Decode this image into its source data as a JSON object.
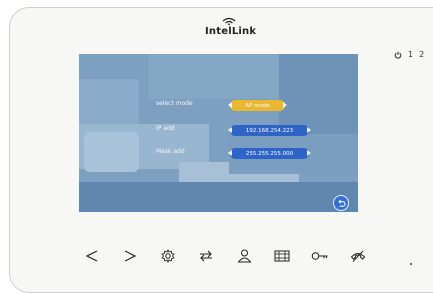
{
  "brand": {
    "name": "IntelLink"
  },
  "status": {
    "icon": "power-icon",
    "channels": [
      "1",
      "2"
    ]
  },
  "settings": {
    "rows": [
      {
        "label": "select mode",
        "value": "AP mode",
        "color": "#e8b830"
      },
      {
        "label": "IP add",
        "value": "192.168.254.223",
        "color": "#2e63c8"
      },
      {
        "label": "Mask add",
        "value": "255.255.255.000",
        "color": "#2e63c8"
      }
    ],
    "back_icon": "return-icon"
  },
  "toolbar": {
    "buttons": [
      {
        "name": "left-arrow-icon"
      },
      {
        "name": "right-arrow-icon"
      },
      {
        "name": "settings-gear-icon"
      },
      {
        "name": "swap-arrows-icon"
      },
      {
        "name": "person-icon"
      },
      {
        "name": "film-icon"
      },
      {
        "name": "key-icon"
      },
      {
        "name": "phone-hangup-icon"
      }
    ]
  }
}
